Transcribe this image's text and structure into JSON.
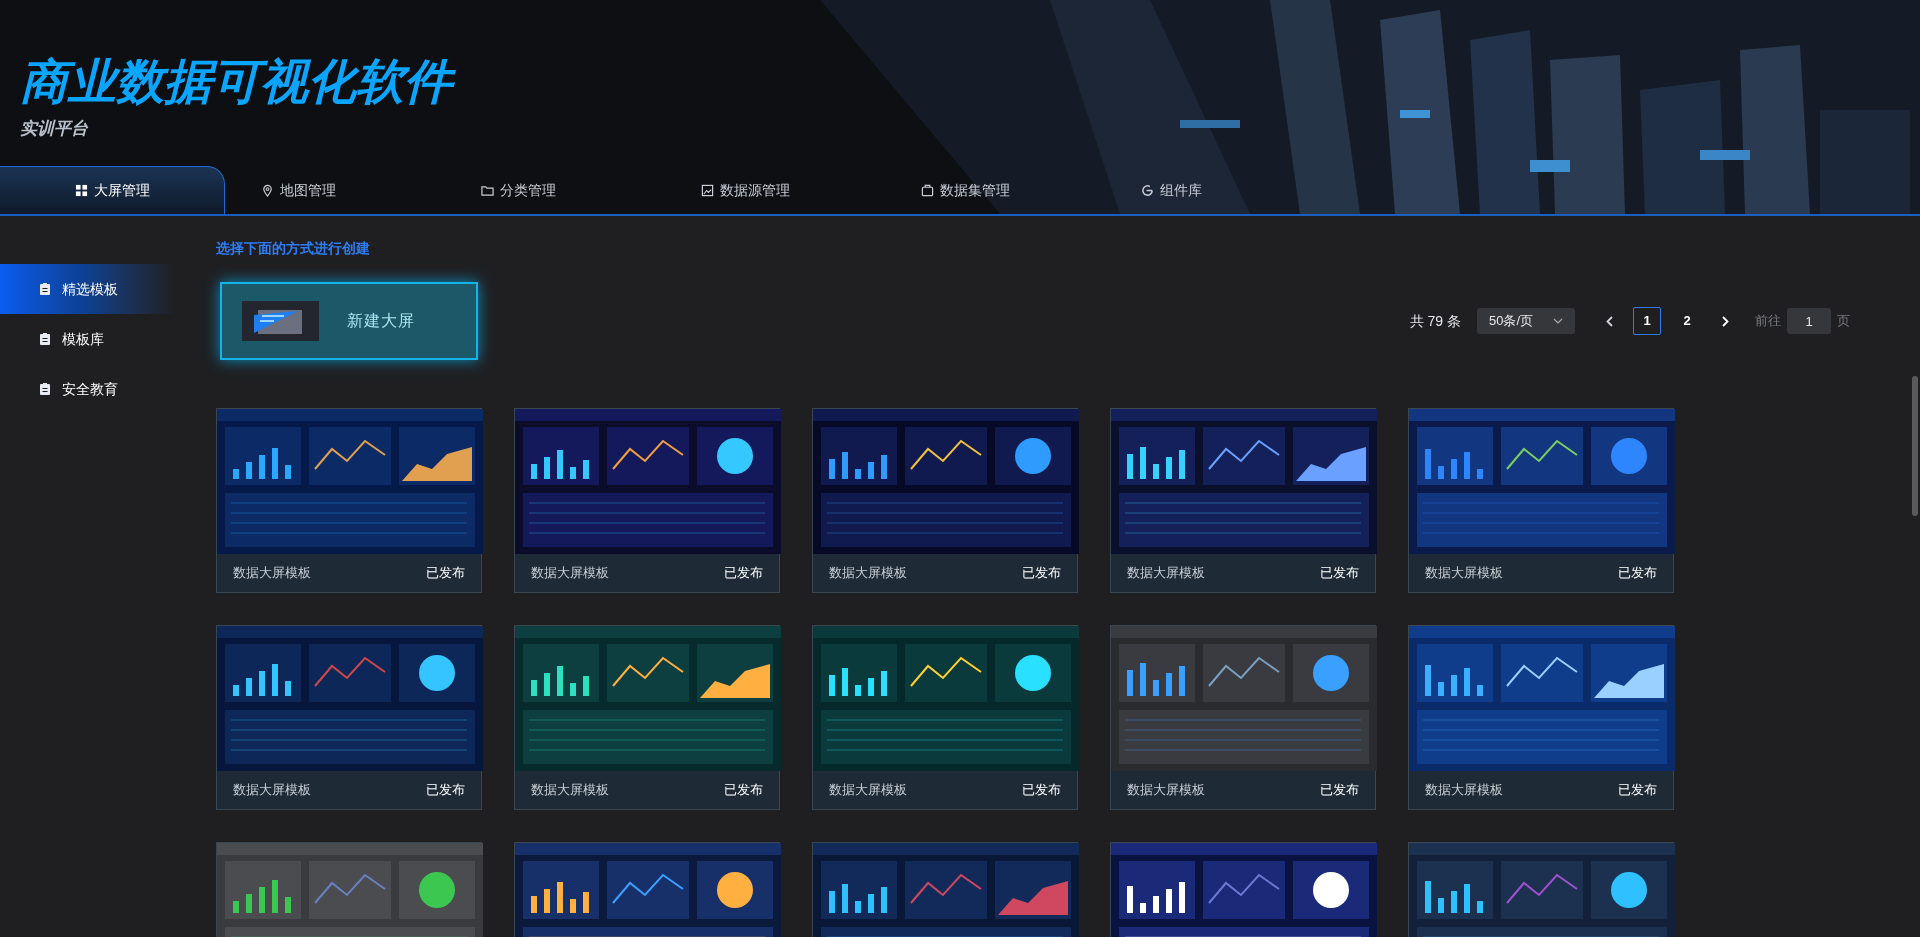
{
  "header": {
    "title": "商业数据可视化软件",
    "subtitle": "实训平台"
  },
  "nav_tabs": [
    {
      "label": "大屏管理",
      "selected": true
    },
    {
      "label": "地图管理",
      "selected": false
    },
    {
      "label": "分类管理",
      "selected": false
    },
    {
      "label": "数据源管理",
      "selected": false
    },
    {
      "label": "数据集管理",
      "selected": false
    },
    {
      "label": "组件库",
      "selected": false
    }
  ],
  "sidebar": {
    "items": [
      {
        "label": "精选模板",
        "selected": true
      },
      {
        "label": "模板库",
        "selected": false
      },
      {
        "label": "安全教育",
        "selected": false
      }
    ]
  },
  "section_heading": "选择下面的方式进行创建",
  "new_button": {
    "label": "新建大屏"
  },
  "pagination": {
    "total": "共 79 条",
    "page_size": "50条/页",
    "pages": [
      {
        "label": "1",
        "selected": true
      },
      {
        "label": "2",
        "selected": false
      }
    ],
    "goto_label": "前往",
    "goto_value": "1",
    "goto_suffix": "页"
  },
  "cards": [
    {
      "kind": "template",
      "title": "数据大屏模板",
      "status": "已发布"
    },
    {
      "kind": "template",
      "title": "数据大屏模板",
      "status": "已发布"
    },
    {
      "kind": "template",
      "title": "数据大屏模板",
      "status": "已发布"
    },
    {
      "kind": "template",
      "title": "数据大屏模板",
      "status": "已发布"
    },
    {
      "kind": "template",
      "title": "数据大屏模板",
      "status": "已发布"
    },
    {
      "kind": "template",
      "title": "数据大屏模板",
      "status": "已发布"
    },
    {
      "kind": "template",
      "title": "数据大屏模板",
      "status": "已发布"
    },
    {
      "kind": "template",
      "title": "数据大屏模板",
      "status": "已发布"
    },
    {
      "kind": "template",
      "title": "数据大屏模板",
      "status": "已发布"
    },
    {
      "kind": "template",
      "title": "数据大屏模板",
      "status": "已发布"
    },
    {
      "kind": "preview"
    },
    {
      "kind": "preview"
    },
    {
      "kind": "preview"
    },
    {
      "kind": "preview"
    },
    {
      "kind": "preview"
    }
  ]
}
